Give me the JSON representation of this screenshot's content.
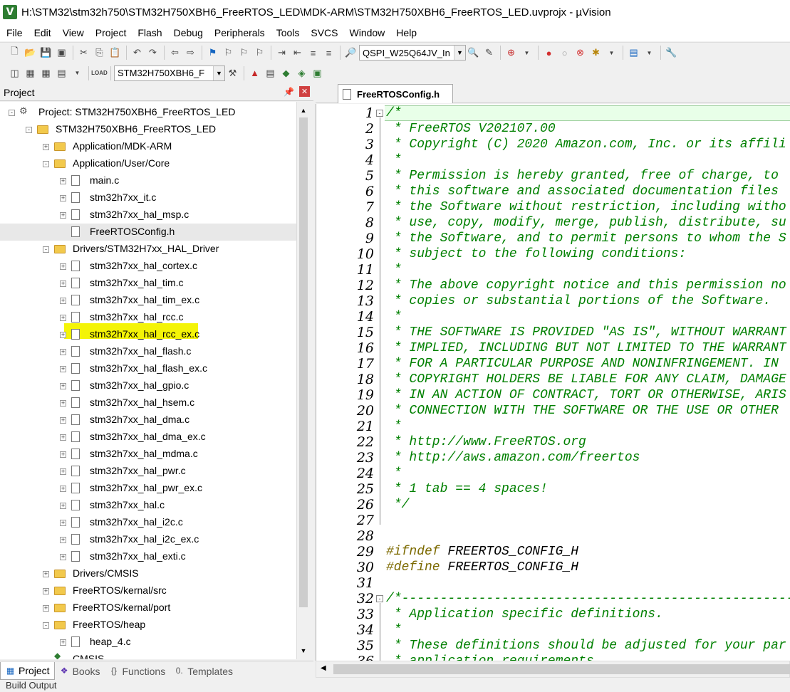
{
  "title": "H:\\STM32\\stm32h750\\STM32H750XBH6_FreeRTOS_LED\\MDK-ARM\\STM32H750XBH6_FreeRTOS_LED.uvprojx - µVision",
  "menu": [
    "File",
    "Edit",
    "View",
    "Project",
    "Flash",
    "Debug",
    "Peripherals",
    "Tools",
    "SVCS",
    "Window",
    "Help"
  ],
  "toolbar": {
    "flash_device": "QSPI_W25Q64JV_In",
    "target": "STM32H750XBH6_F"
  },
  "project_panel": {
    "title": "Project",
    "root": "Project: STM32H750XBH6_FreeRTOS_LED",
    "target": "STM32H750XBH6_FreeRTOS_LED",
    "groups": [
      {
        "name": "Application/MDK-ARM",
        "files": []
      },
      {
        "name": "Application/User/Core",
        "open": true,
        "files": [
          "main.c",
          "stm32h7xx_it.c",
          "stm32h7xx_hal_msp.c",
          "FreeRTOSConfig.h"
        ]
      },
      {
        "name": "Drivers/STM32H7xx_HAL_Driver",
        "open": true,
        "files": [
          "stm32h7xx_hal_cortex.c",
          "stm32h7xx_hal_tim.c",
          "stm32h7xx_hal_tim_ex.c",
          "stm32h7xx_hal_rcc.c",
          "stm32h7xx_hal_rcc_ex.c",
          "stm32h7xx_hal_flash.c",
          "stm32h7xx_hal_flash_ex.c",
          "stm32h7xx_hal_gpio.c",
          "stm32h7xx_hal_hsem.c",
          "stm32h7xx_hal_dma.c",
          "stm32h7xx_hal_dma_ex.c",
          "stm32h7xx_hal_mdma.c",
          "stm32h7xx_hal_pwr.c",
          "stm32h7xx_hal_pwr_ex.c",
          "stm32h7xx_hal.c",
          "stm32h7xx_hal_i2c.c",
          "stm32h7xx_hal_i2c_ex.c",
          "stm32h7xx_hal_exti.c"
        ]
      },
      {
        "name": "Drivers/CMSIS",
        "files": []
      },
      {
        "name": "FreeRTOS/kernal/src",
        "files": []
      },
      {
        "name": "FreeRTOS/kernal/port",
        "files": []
      },
      {
        "name": "FreeRTOS/heap",
        "open": true,
        "files": [
          "heap_4.c"
        ]
      }
    ],
    "partial_item": "CMSIS",
    "selected_file": "FreeRTOSConfig.h"
  },
  "bottom_tabs": [
    "Project",
    "Books",
    "Functions",
    "Templates"
  ],
  "build_output": "Build Output",
  "editor": {
    "tab": "FreeRTOSConfig.h",
    "lines": [
      {
        "n": "1",
        "t": "/*"
      },
      {
        "n": "2",
        "t": " * FreeRTOS V202107.00"
      },
      {
        "n": "3",
        "t": " * Copyright (C) 2020 Amazon.com, Inc. or its affili"
      },
      {
        "n": "4",
        "t": " *"
      },
      {
        "n": "5",
        "t": " * Permission is hereby granted, free of charge, to "
      },
      {
        "n": "6",
        "t": " * this software and associated documentation files "
      },
      {
        "n": "7",
        "t": " * the Software without restriction, including witho"
      },
      {
        "n": "8",
        "t": " * use, copy, modify, merge, publish, distribute, su"
      },
      {
        "n": "9",
        "t": " * the Software, and to permit persons to whom the S"
      },
      {
        "n": "10",
        "t": " * subject to the following conditions:"
      },
      {
        "n": "11",
        "t": " *"
      },
      {
        "n": "12",
        "t": " * The above copyright notice and this permission no"
      },
      {
        "n": "13",
        "t": " * copies or substantial portions of the Software."
      },
      {
        "n": "14",
        "t": " *"
      },
      {
        "n": "15",
        "t": " * THE SOFTWARE IS PROVIDED \"AS IS\", WITHOUT WARRANT"
      },
      {
        "n": "16",
        "t": " * IMPLIED, INCLUDING BUT NOT LIMITED TO THE WARRANT"
      },
      {
        "n": "17",
        "t": " * FOR A PARTICULAR PURPOSE AND NONINFRINGEMENT. IN "
      },
      {
        "n": "18",
        "t": " * COPYRIGHT HOLDERS BE LIABLE FOR ANY CLAIM, DAMAGE"
      },
      {
        "n": "19",
        "t": " * IN AN ACTION OF CONTRACT, TORT OR OTHERWISE, ARIS"
      },
      {
        "n": "20",
        "t": " * CONNECTION WITH THE SOFTWARE OR THE USE OR OTHER "
      },
      {
        "n": "21",
        "t": " *"
      },
      {
        "n": "22",
        "t": " * http://www.FreeRTOS.org"
      },
      {
        "n": "23",
        "t": " * http://aws.amazon.com/freertos"
      },
      {
        "n": "24",
        "t": " *"
      },
      {
        "n": "25",
        "t": " * 1 tab == 4 spaces!"
      },
      {
        "n": "26",
        "t": " */"
      },
      {
        "n": "27",
        "t": ""
      },
      {
        "n": "28",
        "t": ""
      },
      {
        "n": "29",
        "t": "#ifndef FREERTOS_CONFIG_H",
        "pre": true
      },
      {
        "n": "30",
        "t": "#define FREERTOS_CONFIG_H",
        "pre": true
      },
      {
        "n": "31",
        "t": ""
      },
      {
        "n": "32",
        "t": "/*-----------------------------------------------------------"
      },
      {
        "n": "33",
        "t": " * Application specific definitions."
      },
      {
        "n": "34",
        "t": " *"
      },
      {
        "n": "35",
        "t": " * These definitions should be adjusted for your par"
      },
      {
        "n": "36",
        "t": " * application requirements."
      }
    ]
  }
}
